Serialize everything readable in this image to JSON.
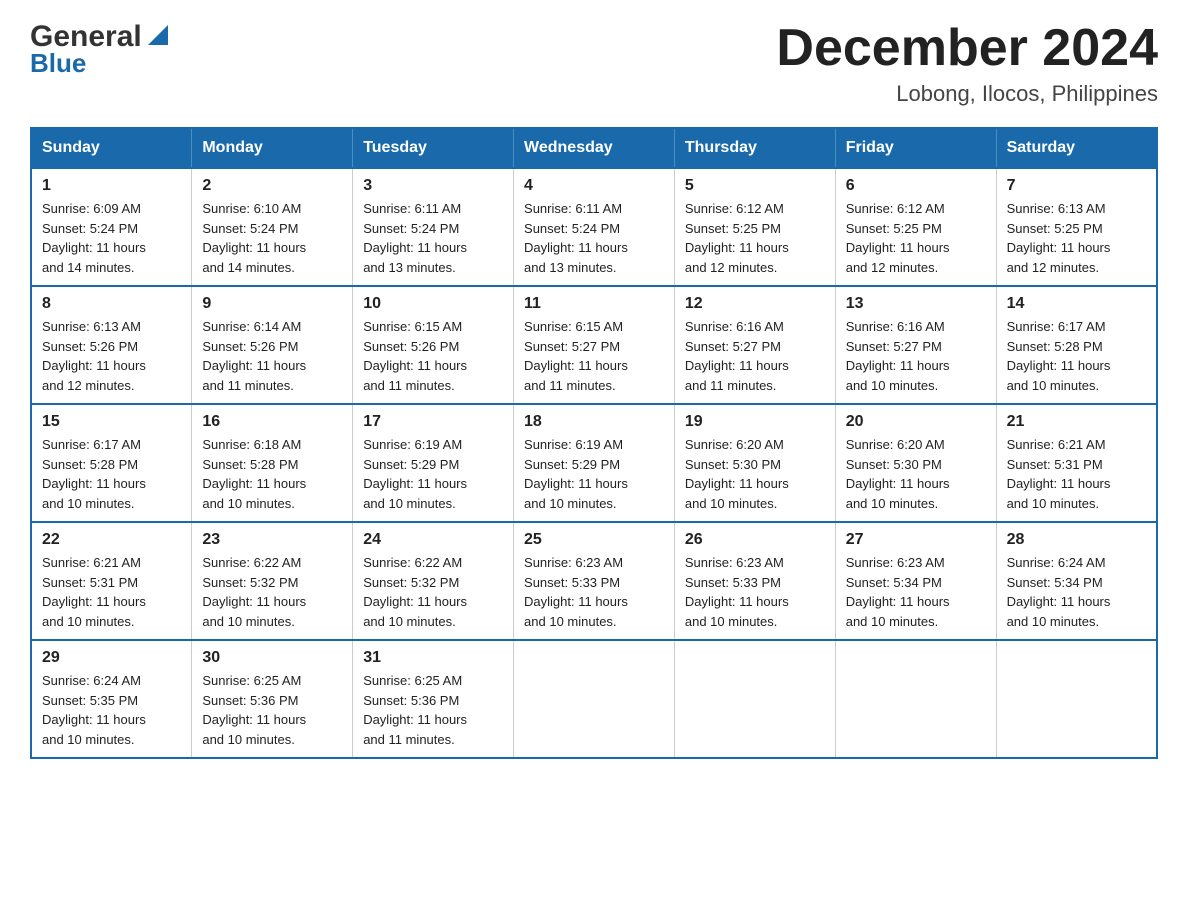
{
  "logo": {
    "general": "General",
    "blue": "Blue"
  },
  "title": "December 2024",
  "subtitle": "Lobong, Ilocos, Philippines",
  "weekdays": [
    "Sunday",
    "Monday",
    "Tuesday",
    "Wednesday",
    "Thursday",
    "Friday",
    "Saturday"
  ],
  "weeks": [
    [
      {
        "day": "1",
        "sunrise": "6:09 AM",
        "sunset": "5:24 PM",
        "daylight": "11 hours and 14 minutes."
      },
      {
        "day": "2",
        "sunrise": "6:10 AM",
        "sunset": "5:24 PM",
        "daylight": "11 hours and 14 minutes."
      },
      {
        "day": "3",
        "sunrise": "6:11 AM",
        "sunset": "5:24 PM",
        "daylight": "11 hours and 13 minutes."
      },
      {
        "day": "4",
        "sunrise": "6:11 AM",
        "sunset": "5:24 PM",
        "daylight": "11 hours and 13 minutes."
      },
      {
        "day": "5",
        "sunrise": "6:12 AM",
        "sunset": "5:25 PM",
        "daylight": "11 hours and 12 minutes."
      },
      {
        "day": "6",
        "sunrise": "6:12 AM",
        "sunset": "5:25 PM",
        "daylight": "11 hours and 12 minutes."
      },
      {
        "day": "7",
        "sunrise": "6:13 AM",
        "sunset": "5:25 PM",
        "daylight": "11 hours and 12 minutes."
      }
    ],
    [
      {
        "day": "8",
        "sunrise": "6:13 AM",
        "sunset": "5:26 PM",
        "daylight": "11 hours and 12 minutes."
      },
      {
        "day": "9",
        "sunrise": "6:14 AM",
        "sunset": "5:26 PM",
        "daylight": "11 hours and 11 minutes."
      },
      {
        "day": "10",
        "sunrise": "6:15 AM",
        "sunset": "5:26 PM",
        "daylight": "11 hours and 11 minutes."
      },
      {
        "day": "11",
        "sunrise": "6:15 AM",
        "sunset": "5:27 PM",
        "daylight": "11 hours and 11 minutes."
      },
      {
        "day": "12",
        "sunrise": "6:16 AM",
        "sunset": "5:27 PM",
        "daylight": "11 hours and 11 minutes."
      },
      {
        "day": "13",
        "sunrise": "6:16 AM",
        "sunset": "5:27 PM",
        "daylight": "11 hours and 10 minutes."
      },
      {
        "day": "14",
        "sunrise": "6:17 AM",
        "sunset": "5:28 PM",
        "daylight": "11 hours and 10 minutes."
      }
    ],
    [
      {
        "day": "15",
        "sunrise": "6:17 AM",
        "sunset": "5:28 PM",
        "daylight": "11 hours and 10 minutes."
      },
      {
        "day": "16",
        "sunrise": "6:18 AM",
        "sunset": "5:28 PM",
        "daylight": "11 hours and 10 minutes."
      },
      {
        "day": "17",
        "sunrise": "6:19 AM",
        "sunset": "5:29 PM",
        "daylight": "11 hours and 10 minutes."
      },
      {
        "day": "18",
        "sunrise": "6:19 AM",
        "sunset": "5:29 PM",
        "daylight": "11 hours and 10 minutes."
      },
      {
        "day": "19",
        "sunrise": "6:20 AM",
        "sunset": "5:30 PM",
        "daylight": "11 hours and 10 minutes."
      },
      {
        "day": "20",
        "sunrise": "6:20 AM",
        "sunset": "5:30 PM",
        "daylight": "11 hours and 10 minutes."
      },
      {
        "day": "21",
        "sunrise": "6:21 AM",
        "sunset": "5:31 PM",
        "daylight": "11 hours and 10 minutes."
      }
    ],
    [
      {
        "day": "22",
        "sunrise": "6:21 AM",
        "sunset": "5:31 PM",
        "daylight": "11 hours and 10 minutes."
      },
      {
        "day": "23",
        "sunrise": "6:22 AM",
        "sunset": "5:32 PM",
        "daylight": "11 hours and 10 minutes."
      },
      {
        "day": "24",
        "sunrise": "6:22 AM",
        "sunset": "5:32 PM",
        "daylight": "11 hours and 10 minutes."
      },
      {
        "day": "25",
        "sunrise": "6:23 AM",
        "sunset": "5:33 PM",
        "daylight": "11 hours and 10 minutes."
      },
      {
        "day": "26",
        "sunrise": "6:23 AM",
        "sunset": "5:33 PM",
        "daylight": "11 hours and 10 minutes."
      },
      {
        "day": "27",
        "sunrise": "6:23 AM",
        "sunset": "5:34 PM",
        "daylight": "11 hours and 10 minutes."
      },
      {
        "day": "28",
        "sunrise": "6:24 AM",
        "sunset": "5:34 PM",
        "daylight": "11 hours and 10 minutes."
      }
    ],
    [
      {
        "day": "29",
        "sunrise": "6:24 AM",
        "sunset": "5:35 PM",
        "daylight": "11 hours and 10 minutes."
      },
      {
        "day": "30",
        "sunrise": "6:25 AM",
        "sunset": "5:36 PM",
        "daylight": "11 hours and 10 minutes."
      },
      {
        "day": "31",
        "sunrise": "6:25 AM",
        "sunset": "5:36 PM",
        "daylight": "11 hours and 11 minutes."
      },
      null,
      null,
      null,
      null
    ]
  ],
  "labels": {
    "sunrise": "Sunrise:",
    "sunset": "Sunset:",
    "daylight": "Daylight:"
  }
}
